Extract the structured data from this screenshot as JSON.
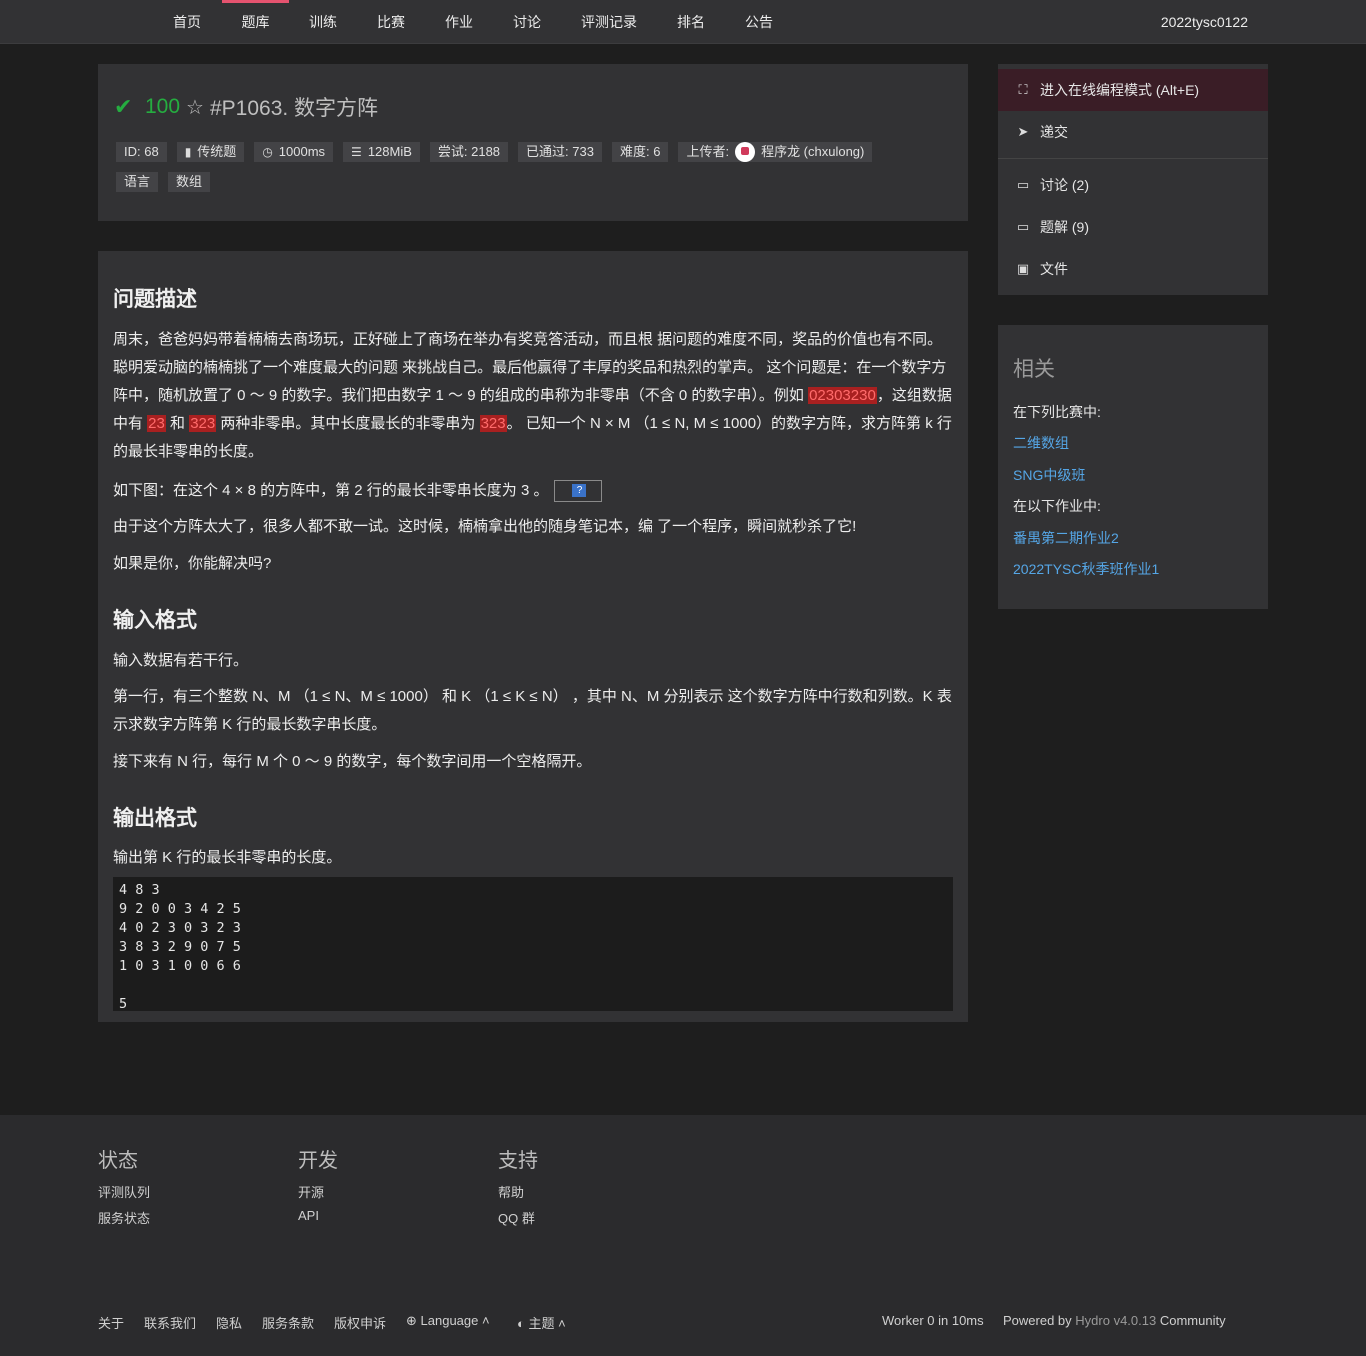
{
  "nav": {
    "items": [
      "首页",
      "题库",
      "训练",
      "比赛",
      "作业",
      "讨论",
      "评测记录",
      "排名",
      "公告"
    ],
    "active": "题库",
    "username": "2022tysc0122"
  },
  "problem": {
    "score": "100",
    "title": "#P1063. 数字方阵",
    "meta": {
      "id": "ID: 68",
      "type": "传统题",
      "time": "1000ms",
      "memory": "128MiB",
      "tries": "尝试: 2188",
      "passed": "已通过: 733",
      "difficulty": "难度: 6",
      "uploader_label": "上传者:",
      "uploader": "程序龙 (chxulong)"
    },
    "tags": [
      "语言",
      "数组"
    ]
  },
  "content": {
    "desc_title": "问题描述",
    "desc_p1_a": "周末，爸爸妈妈带着楠楠去商场玩，正好碰上了商场在举办有奖竞答活动，而且根 据问题的难度不同，奖品的价值也有不同。聪明爱动脑的楠楠挑了一个难度最大的问题 来挑战自己。最后他赢得了丰厚的奖品和热烈的掌声。 这个问题是：在一个数字方阵中，随机放置了 0 ～ 9 的数字。我们把由数字 1 ～ 9 的组成的串称为非零串（不含 0 的数字串）。例如 ",
    "hl1": "02303230",
    "desc_p1_b": "，这组数据中有 ",
    "hl2": "23",
    "desc_p1_c": " 和 ",
    "hl3": "323",
    "desc_p1_d": " 两种非零串。其中长度最长的非零串为 ",
    "hl4": "323",
    "desc_p1_e": "。 已知一个 N × M （1 ≤ N, M ≤ 1000）的数字方阵，求方阵第 k 行的最长非零串的长度。",
    "desc_p2": "如下图：在这个 4 × 8 的方阵中，第 2 行的最长非零串长度为 3 。",
    "desc_p3": "由于这个方阵太大了，很多人都不敢一试。这时候，楠楠拿出他的随身笔记本，编 了一个程序，瞬间就秒杀了它!",
    "desc_p4": "如果是你，你能解决吗?",
    "input_title": "输入格式",
    "input_p1": "输入数据有若干行。",
    "input_p2": "第一行，有三个整数 N、M （1 ≤ N、M ≤ 1000） 和 K （1 ≤ K ≤ N） ，其中 N、M 分别表示 这个数字方阵中行数和列数。K 表示求数字方阵第 K 行的最长数字串长度。",
    "input_p3": "接下来有 N 行，每行 M 个 0 ～ 9 的数字，每个数字间用一个空格隔开。",
    "output_title": "输出格式",
    "output_p1": "输出第 K 行的最长非零串的长度。",
    "sample": "4 8 3\n9 2 0 0 3 4 2 5\n4 0 2 3 0 3 2 3\n3 8 3 2 9 0 7 5\n1 0 3 1 0 0 6 6\n\n5"
  },
  "sidebar": {
    "menu": [
      {
        "icon": "expand-icon",
        "label": "进入在线编程模式 (Alt+E)"
      },
      {
        "icon": "send-icon",
        "label": "递交"
      },
      {
        "icon": "comment-icon",
        "label": "讨论 (2)"
      },
      {
        "icon": "comment-icon",
        "label": "题解 (9)"
      },
      {
        "icon": "file-icon",
        "label": "文件"
      }
    ],
    "related_title": "相关",
    "contest_label": "在下列比赛中:",
    "contests": [
      "二维数组",
      "SNG中级班"
    ],
    "homework_label": "在以下作业中:",
    "homeworks": [
      "番禺第二期作业2",
      "2022TYSC秋季班作业1"
    ]
  },
  "footer": {
    "col1_title": "状态",
    "col1_links": [
      "评测队列",
      "服务状态"
    ],
    "col2_title": "开发",
    "col2_links": [
      "开源",
      "API"
    ],
    "col3_title": "支持",
    "col3_links": [
      "帮助",
      "QQ 群"
    ],
    "bottom_links": [
      "关于",
      "联系我们",
      "隐私",
      "服务条款",
      "版权申诉"
    ],
    "language": "Language",
    "theme": "主题",
    "worker": "Worker 0 in 10ms",
    "powered_prefix": "Powered by",
    "hydro": "Hydro v4.0.13",
    "community": "Community"
  },
  "colors": {
    "accent": "#e5536f",
    "success": "#25ad40",
    "link": "#55a6e6",
    "background": "#1e1e1e",
    "panel": "#323234"
  }
}
